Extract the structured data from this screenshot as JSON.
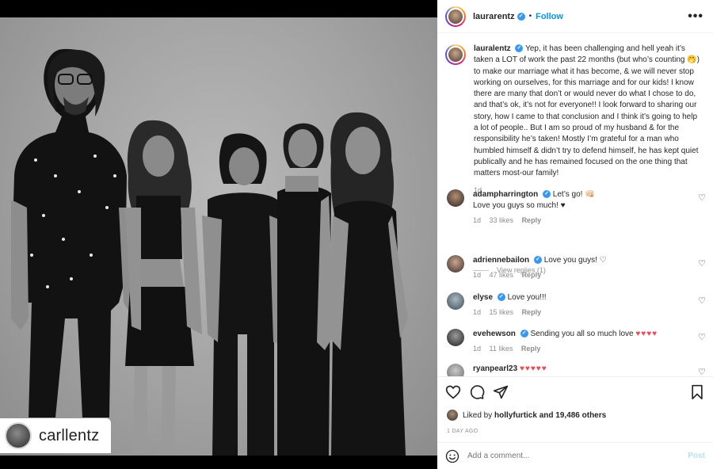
{
  "post": {
    "username": "laurarentz",
    "follow_label": "Follow",
    "more_label": "•••",
    "dot": "•"
  },
  "photo": {
    "repost_username": "carllentz"
  },
  "caption": {
    "username": "lauralentz",
    "text": "Yep, it has been challenging and hell yeah it’s taken a LOT of work the past 22 months (but who’s counting 🤭) to make our marriage what it has become, & we will never stop working on ourselves, for this marriage and for our kids! I know there are many that don’t or would never do what I chose to do, and that’s ok, it’s not for everyone!! I look forward to sharing our story, how I came to that conclusion and I think it’s going to help a lot of people.. But I am so proud of my husband & for the responsibility he’s taken! Mostly I’m grateful for a man who humbled himself & didn’t try to defend himself, he has kept quiet publically and he has remained focused on the one thing that matters most-our family!",
    "time": "1d"
  },
  "comments": [
    {
      "username": "adampharrington",
      "text": "Let’s go! 👊🏻",
      "text2": "Love you guys so much! ♥",
      "time": "1d",
      "likes": "33 likes",
      "reply": "Reply"
    },
    {
      "username": "adriennebailon",
      "text": "Love you guys! ♡",
      "time": "1d",
      "likes": "47 likes",
      "reply": "Reply"
    },
    {
      "username": "elyse",
      "text": "Love you!!!",
      "time": "1d",
      "likes": "15 likes",
      "reply": "Reply"
    },
    {
      "username": "evehewson",
      "text": "Sending you all so much love",
      "hearts": "♥♥♥♥",
      "time": "1d",
      "likes": "11 likes",
      "reply": "Reply"
    },
    {
      "username": "ryanpearl23",
      "hearts": "♥♥♥♥♥"
    }
  ],
  "view_replies": "View replies (1)",
  "likes_bar": {
    "prefix": "Liked by",
    "liker": "hollyfurtick",
    "suffix": "and 19,486 others"
  },
  "timestamp": "1 DAY AGO",
  "add_comment": {
    "placeholder": "Add a comment...",
    "post_label": "Post"
  },
  "colors": {
    "accent": "#0095f6",
    "heart_red": "#ed4956",
    "post_disabled": "#b2dffc"
  }
}
